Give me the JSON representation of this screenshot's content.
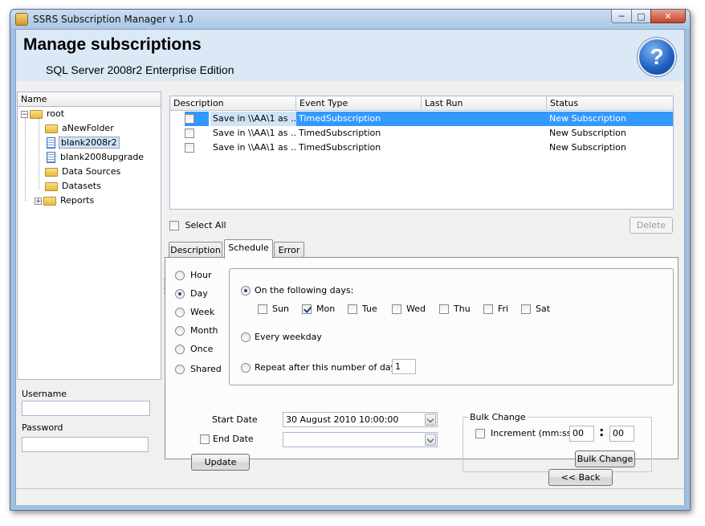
{
  "window": {
    "title": "SSRS Subscription Manager v 1.0",
    "min": "─",
    "max": "□",
    "close": "✕"
  },
  "header": {
    "title": "Manage subscriptions",
    "subtitle": "SQL Server 2008r2 Enterprise Edition",
    "help": "?"
  },
  "tree": {
    "column": "Name",
    "nodes": [
      {
        "label": "root",
        "expander": "−"
      },
      {
        "label": "aNewFolder"
      },
      {
        "label": "blank2008r2"
      },
      {
        "label": "blank2008upgrade"
      },
      {
        "label": "Data Sources"
      },
      {
        "label": "Datasets"
      },
      {
        "label": "Reports",
        "expander": "+"
      }
    ]
  },
  "login": {
    "username_label": "Username",
    "password_label": "Password",
    "username_value": "",
    "password_value": ""
  },
  "grid": {
    "columns": [
      "Description",
      "Event Type",
      "Last Run",
      "Status"
    ],
    "rows": [
      {
        "description": "Save in \\\\AA\\1 as ...",
        "event": "TimedSubscription",
        "last_run": "",
        "status": "New Subscription"
      },
      {
        "description": "Save in \\\\AA\\1 as ...",
        "event": "TimedSubscription",
        "last_run": "",
        "status": "New Subscription"
      },
      {
        "description": "Save in \\\\AA\\1 as ...",
        "event": "TimedSubscription",
        "last_run": "",
        "status": "New Subscription"
      }
    ]
  },
  "select_all": "Select All",
  "delete": "Delete",
  "tabs": [
    "Description",
    "Schedule",
    "Error"
  ],
  "schedule": {
    "frequency": [
      "Hour",
      "Day",
      "Week",
      "Month",
      "Once",
      "Shared"
    ],
    "following_days": "On the following days:",
    "days": [
      "Sun",
      "Mon",
      "Tue",
      "Wed",
      "Thu",
      "Fri",
      "Sat"
    ],
    "every_weekday": "Every weekday",
    "repeat_label": "Repeat after this number of days",
    "repeat_value": "1",
    "start_date_label": "Start Date",
    "start_date_value": "30 August 2010 10:00:00",
    "end_date_label": "End Date",
    "end_date_value": "",
    "update": "Update"
  },
  "bulk": {
    "title": "Bulk Change",
    "increment_label": "Increment (mm:ss)",
    "mm": "00",
    "sep": ":",
    "ss": "00",
    "button": "Bulk Change"
  },
  "back": "<< Back"
}
